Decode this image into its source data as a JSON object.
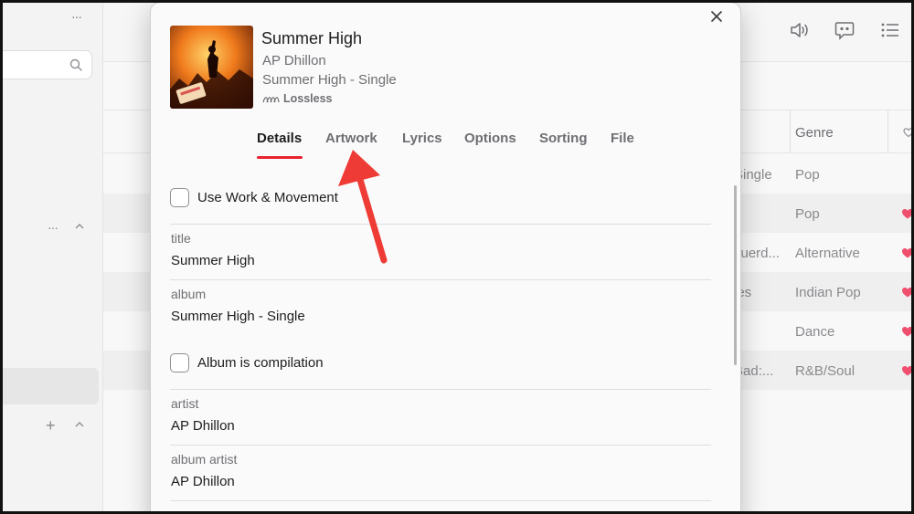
{
  "sidebar": {
    "more_label": "···",
    "search": {
      "placeholder": ""
    },
    "section_more": "···",
    "add_label": "+"
  },
  "toolbar": {
    "speaker_icon": "speaker-icon",
    "lyrics_icon": "lyrics-bubble-icon",
    "queue_icon": "list-icon"
  },
  "table": {
    "genre_header": "Genre",
    "rows": [
      {
        "album": "Single",
        "genre": "Pop",
        "loved": false
      },
      {
        "album": "",
        "genre": "Pop",
        "loved": true
      },
      {
        "album": "cuerd...",
        "genre": "Alternative",
        "loved": true
      },
      {
        "album": "ies",
        "genre": "Indian Pop",
        "loved": true
      },
      {
        "album": "",
        "genre": "Dance",
        "loved": true
      },
      {
        "album": "Bad:...",
        "genre": "R&B/Soul",
        "loved": true
      }
    ]
  },
  "dialog": {
    "title": "Summer High",
    "artist": "AP Dhillon",
    "album": "Summer High - Single",
    "badge": "Lossless",
    "tabs": [
      {
        "label": "Details",
        "active": true
      },
      {
        "label": "Artwork",
        "active": false
      },
      {
        "label": "Lyrics",
        "active": false
      },
      {
        "label": "Options",
        "active": false
      },
      {
        "label": "Sorting",
        "active": false
      },
      {
        "label": "File",
        "active": false
      }
    ],
    "details": {
      "use_work_movement": "Use Work & Movement",
      "title_label": "title",
      "title_value": "Summer High",
      "album_label": "album",
      "album_value": "Summer High - Single",
      "compilation": "Album is compilation",
      "artist_label": "artist",
      "artist_value": "AP Dhillon",
      "album_artist_label": "album artist",
      "album_artist_value": "AP Dhillon"
    }
  },
  "colors": {
    "accent": "#e8222e",
    "annotation_arrow": "#ef3b36"
  }
}
